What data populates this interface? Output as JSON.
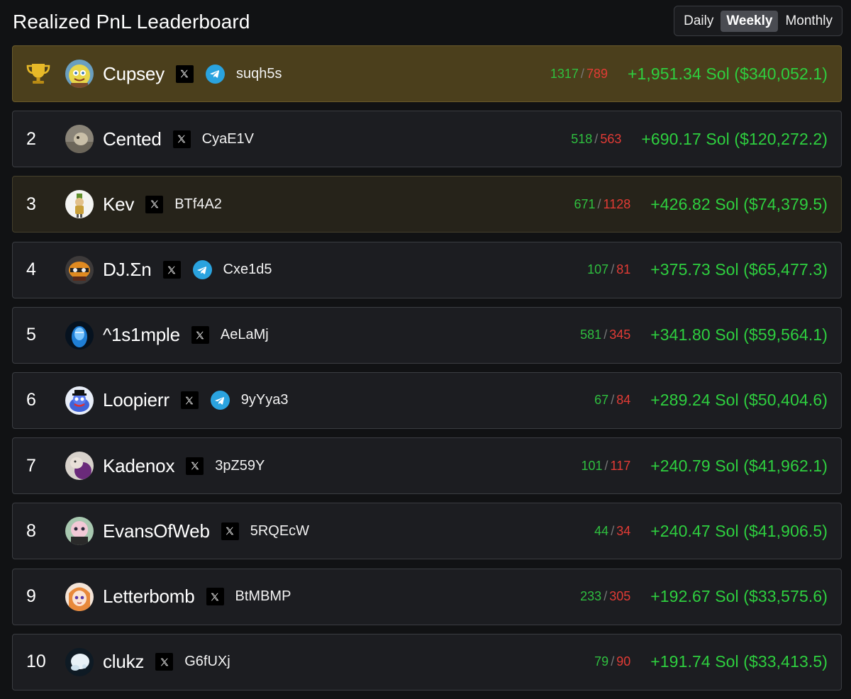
{
  "header": {
    "title": "Realized PnL Leaderboard",
    "periods": [
      "Daily",
      "Weekly",
      "Monthly"
    ],
    "active_period": "Weekly"
  },
  "colors": {
    "win": "#2fbf3f",
    "loss": "#e23b35",
    "pnl": "#2ecf3f",
    "first_row_bg": "#4b3f1c",
    "highlight_row_bg": "#26231a",
    "row_bg": "#1c1d21"
  },
  "icons": {
    "first_place": "trophy-icon",
    "x_link": "x-logo-icon",
    "telegram_link": "telegram-icon"
  },
  "rows": [
    {
      "rank": "",
      "name": "Cupsey",
      "telegram": true,
      "handle": "suqh5s",
      "wins": "1317",
      "losses": "789",
      "pnl": "+1,951.34 Sol ($340,052.1)"
    },
    {
      "rank": "2",
      "name": "Cented",
      "telegram": false,
      "handle": "CyaE1V",
      "wins": "518",
      "losses": "563",
      "pnl": "+690.17 Sol ($120,272.2)"
    },
    {
      "rank": "3",
      "name": "Kev",
      "telegram": false,
      "handle": "BTf4A2",
      "wins": "671",
      "losses": "1128",
      "pnl": "+426.82 Sol ($74,379.5)"
    },
    {
      "rank": "4",
      "name": "DJ.Σn",
      "telegram": true,
      "handle": "Cxe1d5",
      "wins": "107",
      "losses": "81",
      "pnl": "+375.73 Sol ($65,477.3)"
    },
    {
      "rank": "5",
      "name": "^1s1mple",
      "telegram": false,
      "handle": "AeLaMj",
      "wins": "581",
      "losses": "345",
      "pnl": "+341.80 Sol ($59,564.1)"
    },
    {
      "rank": "6",
      "name": "Loopierr",
      "telegram": true,
      "handle": "9yYya3",
      "wins": "67",
      "losses": "84",
      "pnl": "+289.24 Sol ($50,404.6)"
    },
    {
      "rank": "7",
      "name": "Kadenox",
      "telegram": false,
      "handle": "3pZ59Y",
      "wins": "101",
      "losses": "117",
      "pnl": "+240.79 Sol ($41,962.1)"
    },
    {
      "rank": "8",
      "name": "EvansOfWeb",
      "telegram": false,
      "handle": "5RQEcW",
      "wins": "44",
      "losses": "34",
      "pnl": "+240.47 Sol ($41,906.5)"
    },
    {
      "rank": "9",
      "name": "Letterbomb",
      "telegram": false,
      "handle": "BtMBMP",
      "wins": "233",
      "losses": "305",
      "pnl": "+192.67 Sol ($33,575.6)"
    },
    {
      "rank": "10",
      "name": "clukz",
      "telegram": false,
      "handle": "G6fUXj",
      "wins": "79",
      "losses": "90",
      "pnl": "+191.74 Sol ($33,413.5)"
    }
  ]
}
